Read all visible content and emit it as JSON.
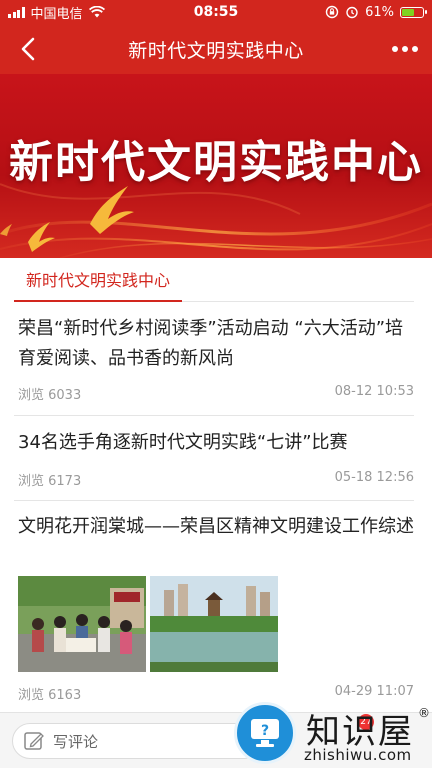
{
  "status_bar": {
    "carrier": "中国电信",
    "time": "08:55",
    "battery_percent": "61%",
    "battery_level": 0.61,
    "icons": [
      "signal-icon",
      "wifi-icon",
      "lock-rotation-icon",
      "alarm-icon",
      "battery-icon"
    ]
  },
  "nav": {
    "title": "新时代文明实践中心",
    "back_icon": "back-chevron-icon",
    "more_icon": "more-dots-icon"
  },
  "banner": {
    "text": "新时代文明实践中心"
  },
  "section": {
    "tab_label": "新时代文明实践中心"
  },
  "articles": [
    {
      "title": "荣昌“新时代乡村阅读季”活动启动 “六大活动”培育爱阅读、品书香的新风尚",
      "views": "浏览 6033",
      "date": "08-12 10:53"
    },
    {
      "title": "34名选手角逐新时代文明实践“七讲”比赛",
      "views": "浏览 6173",
      "date": "05-18 12:56"
    },
    {
      "title": "文明花开润棠城——荣昌区精神文明建设工作综述",
      "views": "浏览 6163",
      "date": "04-29 11:07"
    }
  ],
  "bottom_bar": {
    "comment_placeholder": "写评论",
    "comment_icon": "edit-icon"
  },
  "watermark": {
    "text": "知识屋",
    "sub": "zhishiwu.com",
    "badge": "27",
    "reg": "®"
  },
  "colors": {
    "brand_red": "#d2261e",
    "meta_gray": "#9a9a9a"
  }
}
